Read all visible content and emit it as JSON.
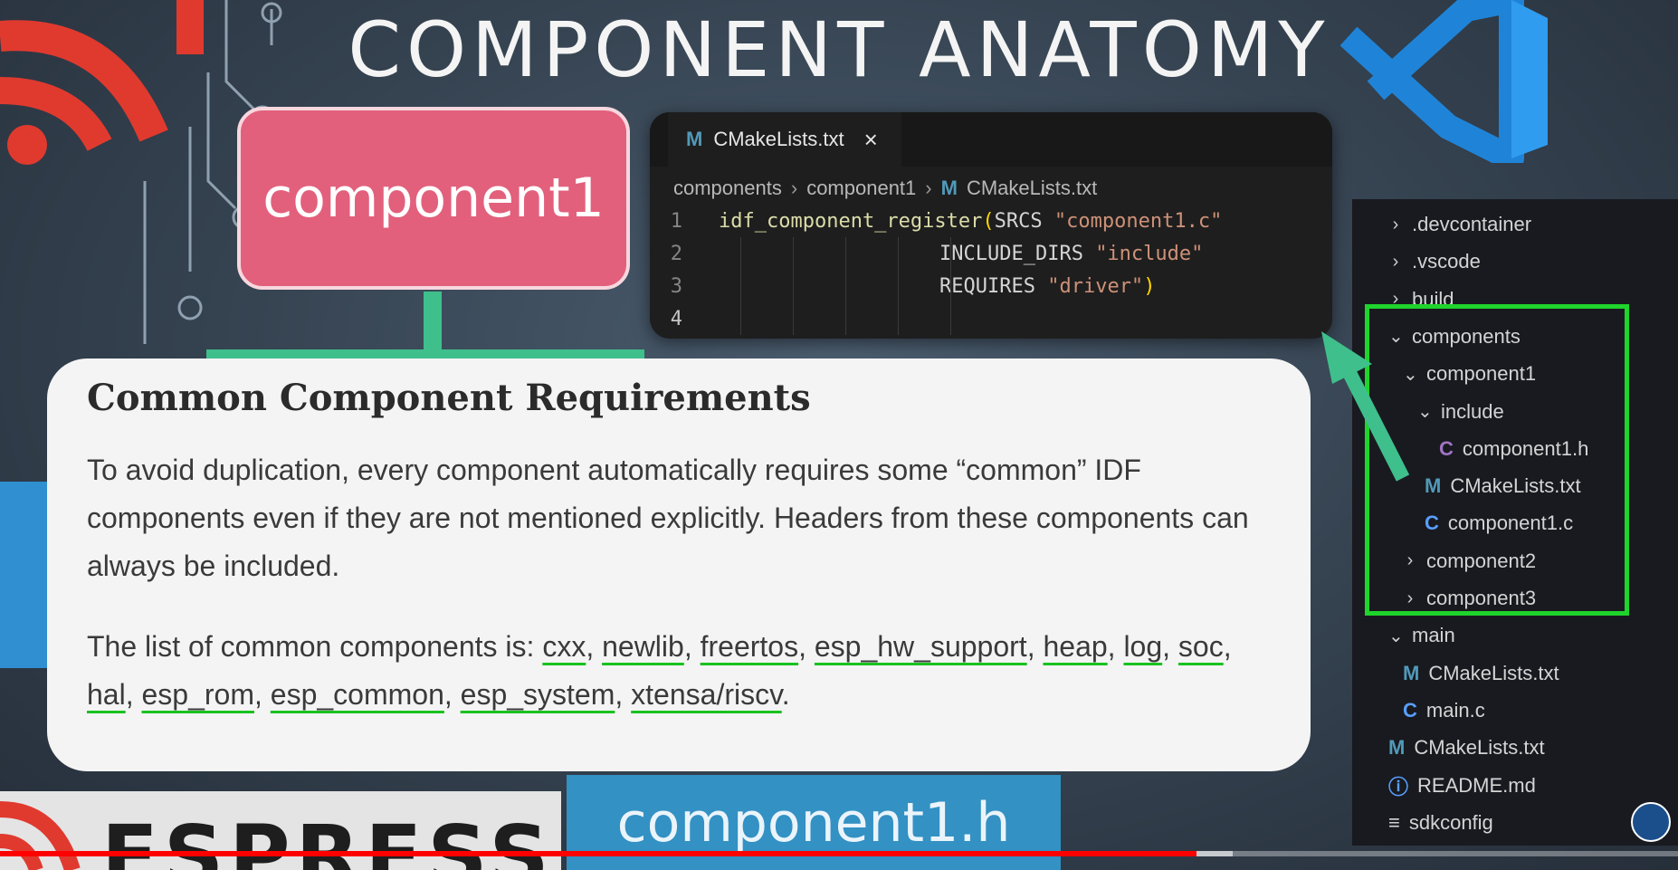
{
  "slide": {
    "title": "COMPONENT ANATOMY"
  },
  "component_box": {
    "label": "component1"
  },
  "editor": {
    "tab_icon": "M",
    "tab_label": "CMakeLists.txt",
    "tab_close": "×",
    "breadcrumb": [
      "components",
      "component1",
      "CMakeLists.txt"
    ],
    "breadcrumb_icon": "M",
    "lines": [
      {
        "num": "1",
        "func": "idf_component_register",
        "open": "(",
        "kw": "SRCS ",
        "str": "\"component1.c\"",
        "close": ""
      },
      {
        "num": "2",
        "func": "",
        "open": "",
        "kw": "INCLUDE_DIRS ",
        "str": "\"include\"",
        "close": ""
      },
      {
        "num": "3",
        "func": "",
        "open": "",
        "kw": "REQUIRES ",
        "str": "\"driver\"",
        "close": ")"
      },
      {
        "num": "4",
        "func": "",
        "open": "",
        "kw": "",
        "str": "",
        "close": ""
      }
    ]
  },
  "explorer": {
    "items": [
      {
        "label": ".devcontainer",
        "chev": "›",
        "icon": ""
      },
      {
        "label": ".vscode",
        "chev": "›",
        "icon": ""
      },
      {
        "label": "build",
        "chev": "›",
        "icon": ""
      },
      {
        "label": "components",
        "chev": "⌄",
        "icon": ""
      },
      {
        "label": "component1",
        "chev": "⌄",
        "icon": ""
      },
      {
        "label": "include",
        "chev": "⌄",
        "icon": ""
      },
      {
        "label": "component1.h",
        "chev": "",
        "icon": "C"
      },
      {
        "label": "CMakeLists.txt",
        "chev": "",
        "icon": "M"
      },
      {
        "label": "component1.c",
        "chev": "",
        "icon": "C"
      },
      {
        "label": "component2",
        "chev": "›",
        "icon": ""
      },
      {
        "label": "component3",
        "chev": "›",
        "icon": ""
      },
      {
        "label": "main",
        "chev": "⌄",
        "icon": ""
      },
      {
        "label": "CMakeLists.txt",
        "chev": "",
        "icon": "M"
      },
      {
        "label": "main.c",
        "chev": "",
        "icon": "C"
      },
      {
        "label": "CMakeLists.txt",
        "chev": "",
        "icon": "M"
      },
      {
        "label": "README.md",
        "chev": "",
        "icon": "ⓘ"
      },
      {
        "label": "sdkconfig",
        "chev": "",
        "icon": "≡"
      }
    ]
  },
  "doc": {
    "heading": "Common Component Requirements",
    "para1": "To avoid duplication, every component automatically requires some “common” IDF components even if they are not mentioned explicitly. Headers from these components can always be included.",
    "para2_prefix": "The list of common components is: ",
    "components": [
      "cxx",
      "newlib",
      "freertos",
      "esp_hw_support",
      "heap",
      "log",
      "soc",
      "hal",
      "esp_rom",
      "esp_common",
      "esp_system",
      "xtensa/riscv"
    ],
    "sep": ", ",
    "end": "."
  },
  "bottom": {
    "espressif": "ESPRESSIF",
    "header_file": "component1.h"
  },
  "video": {
    "progress": 0.713
  },
  "colors": {
    "accent_green": "#1fd42c",
    "pink": "#e2607c",
    "teal": "#3fbf8c",
    "blue": "#3391c4"
  }
}
